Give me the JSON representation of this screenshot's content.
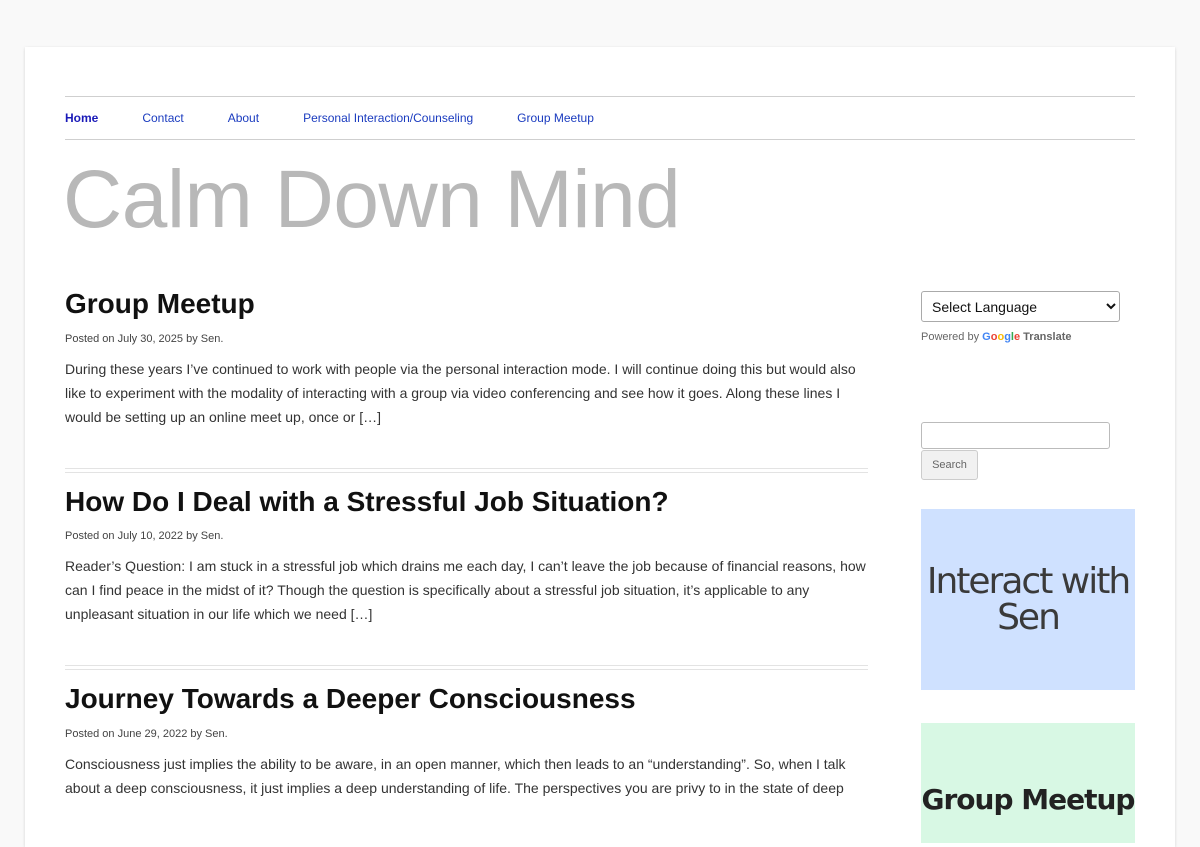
{
  "nav": {
    "items": [
      {
        "label": "Home"
      },
      {
        "label": "Contact"
      },
      {
        "label": "About"
      },
      {
        "label": "Personal Interaction/Counseling"
      },
      {
        "label": "Group Meetup"
      }
    ]
  },
  "site": {
    "title": "Calm Down Mind"
  },
  "posts": [
    {
      "title": "Group Meetup",
      "meta": "Posted on July 30, 2025 by Sen.",
      "excerpt": "During these years I’ve continued to work with people via the personal interaction mode. I will continue doing this but would also like to experiment with the modality of interacting with a group via video conferencing and see how it goes. Along these lines I would be setting up an online meet up, once or […]"
    },
    {
      "title": "How Do I Deal with a Stressful Job Situation?",
      "meta": "Posted on July 10, 2022 by Sen.",
      "excerpt": "Reader’s Question: I am stuck in a stressful job which drains me each day, I can’t leave the job because of financial reasons, how can I find peace in the midst of it? Though the question is specifically about a stressful job situation, it’s applicable to any unpleasant situation in our life which we need […]"
    },
    {
      "title": "Journey Towards a Deeper Consciousness",
      "meta": "Posted on June 29, 2022 by Sen.",
      "excerpt": "Consciousness just implies the ability to be aware, in an open manner, which then leads to an “understanding”. So, when I talk about a deep consciousness, it just implies a deep understanding of life. The perspectives you are privy to in the state of deep"
    }
  ],
  "sidebar": {
    "translate": {
      "select_label": "Select Language",
      "powered_by": "Powered by",
      "google": "Google",
      "translate": "Translate"
    },
    "search": {
      "button_label": "Search",
      "value": ""
    },
    "interact_image_text": "Interact with Sen",
    "group_image_text": "Group Meetup"
  }
}
